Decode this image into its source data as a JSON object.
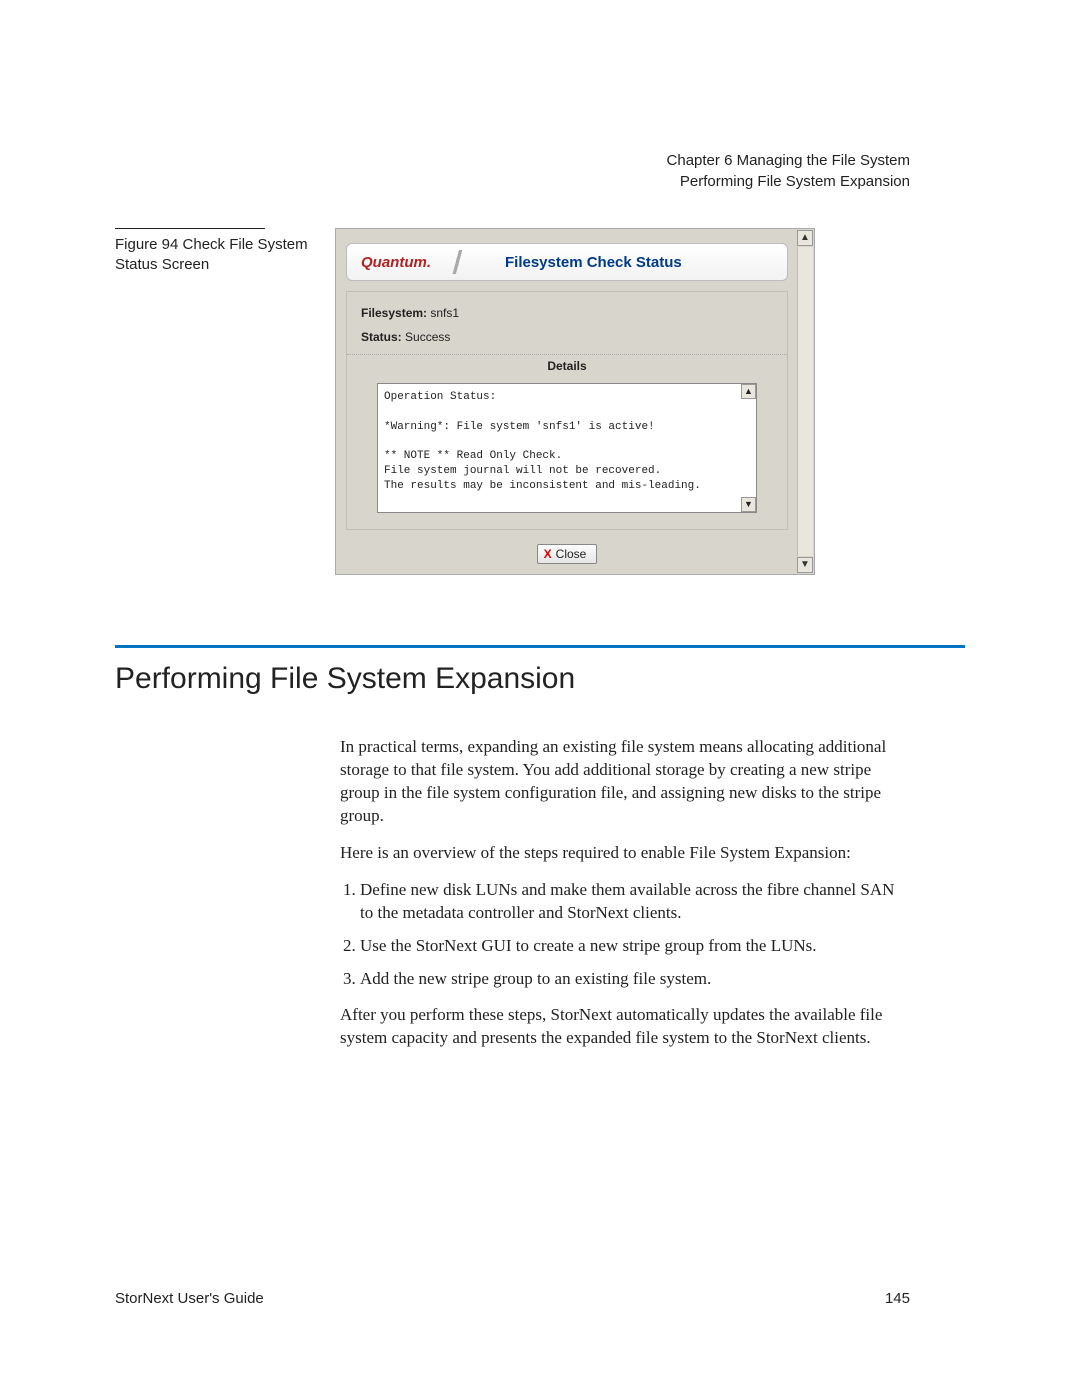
{
  "header": {
    "chapter_line": "Chapter 6  Managing the File System",
    "topic_line": "Performing File System Expansion"
  },
  "figure": {
    "caption": "Figure 94  Check File System Status Screen"
  },
  "screenshot": {
    "brand": "Quantum.",
    "title": "Filesystem Check Status",
    "filesystem_label": "Filesystem:",
    "filesystem_value": "snfs1",
    "status_label": "Status:",
    "status_value": "Success",
    "details_heading": "Details",
    "log_text": "Operation Status:\n\n*Warning*: File system 'snfs1' is active!\n\n** NOTE ** Read Only Check.\nFile system journal will not be recovered.\nThe results may be inconsistent and mis-leading.",
    "close_label": "Close"
  },
  "section": {
    "heading": "Performing File System Expansion",
    "para1": "In practical terms, expanding an existing file system means allocating additional storage to that file system. You add additional storage by creating a new stripe group in the file system configuration file, and assigning new disks to the stripe group.",
    "para2": "Here is an overview of the steps required to enable File System Expansion:",
    "steps": [
      "Define new disk LUNs and make them available across the fibre channel SAN to the metadata controller and StorNext clients.",
      "Use the StorNext GUI to create a new stripe group from the LUNs.",
      "Add the new stripe group to an existing file system."
    ],
    "para3": "After you perform these steps, StorNext automatically updates the available file system capacity and presents the expanded file system to the StorNext clients."
  },
  "footer": {
    "guide": "StorNext User's Guide",
    "page": "145"
  }
}
